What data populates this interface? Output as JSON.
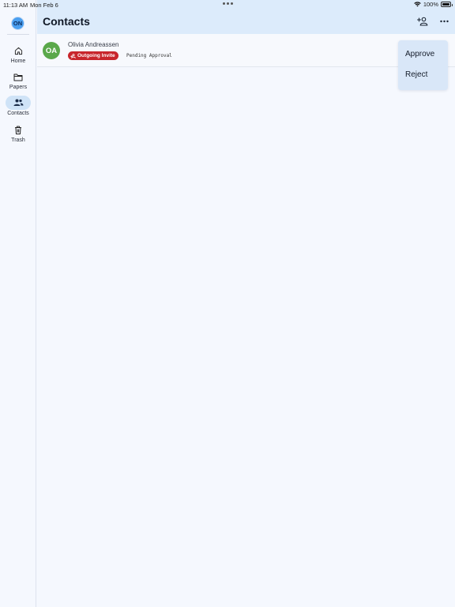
{
  "status_bar": {
    "time": "11:13 AM",
    "date": "Mon Feb 6",
    "battery": "100%",
    "battery_level": 1.0
  },
  "sidebar": {
    "avatar_initials": "ON",
    "items": [
      {
        "label": "Home",
        "icon": "home-icon",
        "active": false
      },
      {
        "label": "Papers",
        "icon": "folder-icon",
        "active": false
      },
      {
        "label": "Contacts",
        "icon": "people-icon",
        "active": true
      },
      {
        "label": "Trash",
        "icon": "trash-icon",
        "active": false
      }
    ]
  },
  "header": {
    "title": "Contacts",
    "actions": [
      "add-contact-icon",
      "more-icon"
    ]
  },
  "contacts": [
    {
      "initials": "OA",
      "name": "Olivia Andreassen",
      "badge": "Outgoing Invite",
      "status": "Pending Approval"
    }
  ],
  "context_menu": {
    "items": [
      "Approve",
      "Reject"
    ]
  },
  "colors": {
    "accent": "#dcebfb",
    "avatar_user": "#4a9ff0",
    "avatar_contact": "#5aa84a",
    "badge_red": "#c8262c",
    "active_nav": "#cfe3f7"
  }
}
